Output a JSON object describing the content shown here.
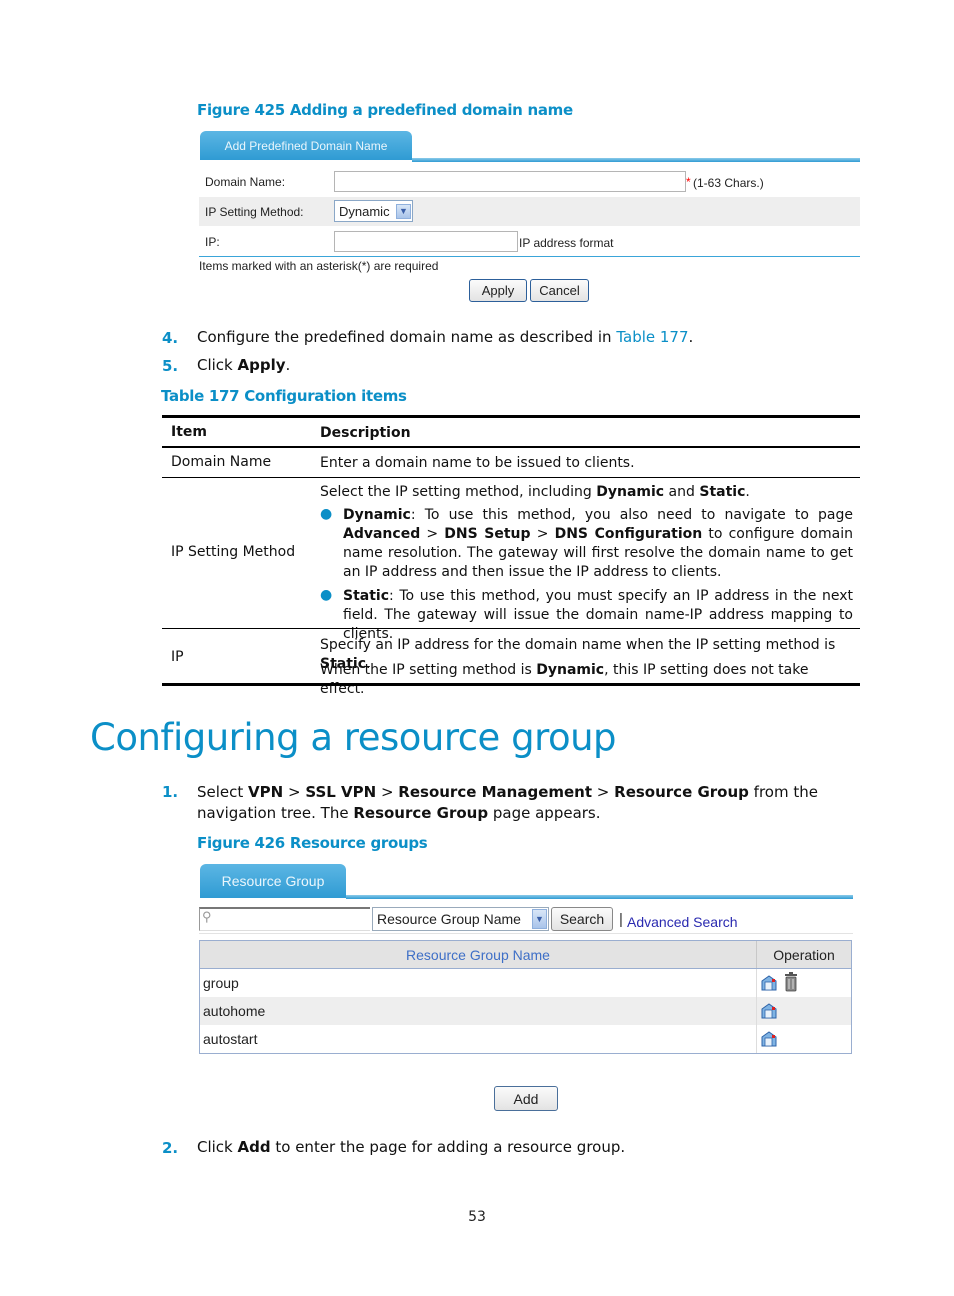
{
  "figure425": {
    "caption": "Figure 425 Adding a predefined domain name",
    "tab_label": "Add Predefined Domain Name",
    "fields": {
      "domain_name": {
        "label": "Domain Name:",
        "value": "",
        "required_mark": "*",
        "hint": "(1-63 Chars.)"
      },
      "ip_setting_method": {
        "label": "IP Setting Method:",
        "selected": "Dynamic"
      },
      "ip": {
        "label": "IP:",
        "value": "",
        "hint": "IP address format"
      }
    },
    "required_note": "Items marked with an asterisk(*) are required",
    "apply_label": "Apply",
    "cancel_label": "Cancel"
  },
  "steps_a": [
    {
      "num": "4.",
      "text_before": "Configure the predefined domain name as described in ",
      "link": "Table 177",
      "text_after": "."
    },
    {
      "num": "5.",
      "text_before": "Click ",
      "bold": "Apply",
      "text_after": "."
    }
  ],
  "table177": {
    "caption": "Table 177 Configuration items",
    "headers": [
      "Item",
      "Description"
    ],
    "rows": [
      {
        "item": "Domain Name",
        "desc": "Enter a domain name to be issued to clients."
      },
      {
        "item": "IP Setting Method",
        "intro": {
          "t1": "Select the IP setting method, including ",
          "b1": "Dynamic",
          "t2": " and ",
          "b2": "Static",
          "t3": "."
        },
        "bullets": [
          {
            "b1": "Dynamic",
            "t1": ": To use this method, you also need to navigate to page ",
            "b2": "Advanced",
            "t2": " > ",
            "b3": "DNS Setup",
            "t3": " > ",
            "b4": "DNS Configuration",
            "t4": " to configure domain name resolution. The gateway will first resolve the domain name to get an IP address and then issue the IP address to clients."
          },
          {
            "b1": "Static",
            "t1": ": To use this method, you must specify an IP address in the next field. The gateway will issue the domain name-IP address mapping to clients."
          }
        ]
      },
      {
        "item": "IP",
        "line1": {
          "t1": "Specify an IP address for the domain name when the IP setting method is ",
          "b1": "Static",
          "t2": "."
        },
        "line2": {
          "t1": "When the IP setting method is ",
          "b1": "Dynamic",
          "t2": ", this IP setting does not take effect."
        }
      }
    ]
  },
  "section": {
    "heading": "Configuring a resource group",
    "step1": {
      "num": "1.",
      "t1": "Select ",
      "b1": "VPN",
      "t2": " > ",
      "b2": "SSL VPN",
      "t3": " > ",
      "b3": "Resource Management",
      "t4": " > ",
      "b4": "Resource Group",
      "t5": " from the navigation tree. The ",
      "b5": "Resource Group",
      "t6": " page appears."
    },
    "step2": {
      "num": "2.",
      "t1": "Click ",
      "b1": "Add",
      "t2": " to enter the page for adding a resource group."
    }
  },
  "figure426": {
    "caption": "Figure 426 Resource groups",
    "tab_label": "Resource Group",
    "search_value": "",
    "search_field_selected": "Resource Group Name",
    "search_label": "Search",
    "separator": "|",
    "advanced_search_label": "Advanced Search",
    "columns": [
      "Resource Group Name",
      "Operation"
    ],
    "rows": [
      {
        "name": "group",
        "ops": [
          "edit-icon",
          "delete-icon"
        ]
      },
      {
        "name": "autohome",
        "ops": [
          "edit-icon"
        ]
      },
      {
        "name": "autostart",
        "ops": [
          "edit-icon"
        ]
      }
    ],
    "add_label": "Add"
  },
  "page_number": "53",
  "colors": {
    "accent": "#0b8fc7",
    "tab": "#2f9bd3",
    "row_alt": "#eeeeee",
    "link_dark": "#2a2ab0",
    "required": "#ff0000"
  }
}
